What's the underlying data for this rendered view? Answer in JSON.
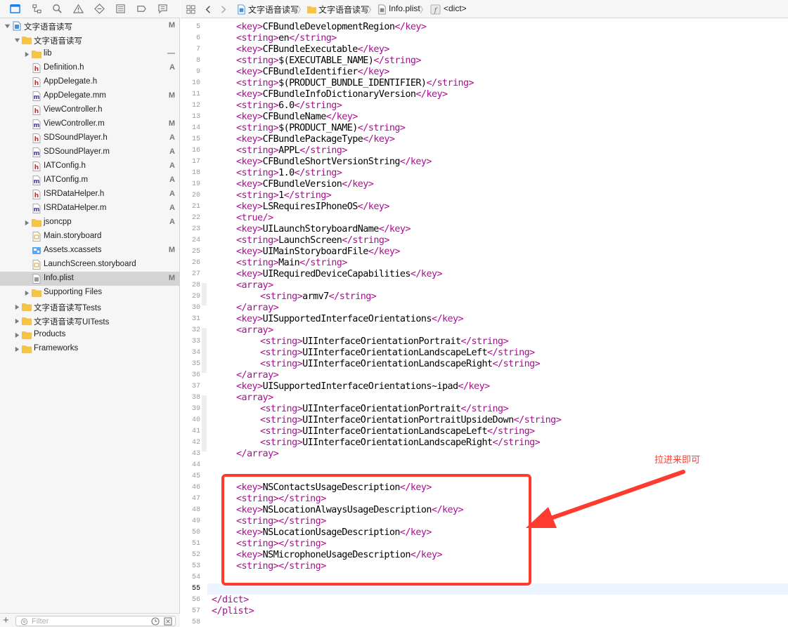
{
  "navigator": {
    "filter_placeholder": "Filter",
    "tree": [
      {
        "name": "文字语音读写",
        "badge": "M",
        "icon": "project-icon",
        "level": 0,
        "disclosure": "open"
      },
      {
        "name": "文字语音读写",
        "badge": "",
        "icon": "folder-icon",
        "level": 1,
        "disclosure": "open"
      },
      {
        "name": "lib",
        "badge": "—",
        "icon": "folder-icon",
        "level": 2,
        "disclosure": "closed"
      },
      {
        "name": "Definition.h",
        "badge": "A",
        "icon": "header-file-icon",
        "level": 2,
        "disclosure": ""
      },
      {
        "name": "AppDelegate.h",
        "badge": "",
        "icon": "header-file-icon",
        "level": 2,
        "disclosure": ""
      },
      {
        "name": "AppDelegate.mm",
        "badge": "M",
        "icon": "source-file-icon",
        "level": 2,
        "disclosure": ""
      },
      {
        "name": "ViewController.h",
        "badge": "",
        "icon": "header-file-icon",
        "level": 2,
        "disclosure": ""
      },
      {
        "name": "ViewController.m",
        "badge": "M",
        "icon": "source-file-icon",
        "level": 2,
        "disclosure": ""
      },
      {
        "name": "SDSoundPlayer.h",
        "badge": "A",
        "icon": "header-file-icon",
        "level": 2,
        "disclosure": ""
      },
      {
        "name": "SDSoundPlayer.m",
        "badge": "A",
        "icon": "source-file-icon",
        "level": 2,
        "disclosure": ""
      },
      {
        "name": "IATConfig.h",
        "badge": "A",
        "icon": "header-file-icon",
        "level": 2,
        "disclosure": ""
      },
      {
        "name": "IATConfig.m",
        "badge": "A",
        "icon": "source-file-icon",
        "level": 2,
        "disclosure": ""
      },
      {
        "name": "ISRDataHelper.h",
        "badge": "A",
        "icon": "header-file-icon",
        "level": 2,
        "disclosure": ""
      },
      {
        "name": "ISRDataHelper.m",
        "badge": "A",
        "icon": "source-file-icon",
        "level": 2,
        "disclosure": ""
      },
      {
        "name": "jsoncpp",
        "badge": "A",
        "icon": "folder-icon",
        "level": 2,
        "disclosure": "closed"
      },
      {
        "name": "Main.storyboard",
        "badge": "",
        "icon": "storyboard-icon",
        "level": 2,
        "disclosure": ""
      },
      {
        "name": "Assets.xcassets",
        "badge": "M",
        "icon": "asset-catalog-icon",
        "level": 2,
        "disclosure": ""
      },
      {
        "name": "LaunchScreen.storyboard",
        "badge": "",
        "icon": "storyboard-icon",
        "level": 2,
        "disclosure": ""
      },
      {
        "name": "Info.plist",
        "badge": "M",
        "icon": "plist-file-icon",
        "level": 2,
        "disclosure": "",
        "selected": true
      },
      {
        "name": "Supporting Files",
        "badge": "",
        "icon": "folder-icon",
        "level": 2,
        "disclosure": "closed"
      },
      {
        "name": "文字语音读写Tests",
        "badge": "",
        "icon": "folder-icon",
        "level": 1,
        "disclosure": "closed"
      },
      {
        "name": "文字语音读写UITests",
        "badge": "",
        "icon": "folder-icon",
        "level": 1,
        "disclosure": "closed"
      },
      {
        "name": "Products",
        "badge": "",
        "icon": "folder-icon",
        "level": 1,
        "disclosure": "closed"
      },
      {
        "name": "Frameworks",
        "badge": "",
        "icon": "folder-icon",
        "level": 1,
        "disclosure": "closed"
      }
    ]
  },
  "jumpbar": {
    "items": [
      "文字语音读写",
      "文字语音读写",
      "Info.plist",
      "<dict>"
    ]
  },
  "editor": {
    "current_line": 55,
    "lines": [
      {
        "n": 5,
        "indent": 1,
        "parts": [
          [
            "t",
            "<key>"
          ],
          [
            "x",
            "CFBundleDevelopmentRegion"
          ],
          [
            "t",
            "</key>"
          ]
        ]
      },
      {
        "n": 6,
        "indent": 1,
        "parts": [
          [
            "t",
            "<string>"
          ],
          [
            "x",
            "en"
          ],
          [
            "t",
            "</string>"
          ]
        ]
      },
      {
        "n": 7,
        "indent": 1,
        "parts": [
          [
            "t",
            "<key>"
          ],
          [
            "x",
            "CFBundleExecutable"
          ],
          [
            "t",
            "</key>"
          ]
        ]
      },
      {
        "n": 8,
        "indent": 1,
        "parts": [
          [
            "t",
            "<string>"
          ],
          [
            "x",
            "$(EXECUTABLE_NAME)"
          ],
          [
            "t",
            "</string>"
          ]
        ]
      },
      {
        "n": 9,
        "indent": 1,
        "parts": [
          [
            "t",
            "<key>"
          ],
          [
            "x",
            "CFBundleIdentifier"
          ],
          [
            "t",
            "</key>"
          ]
        ]
      },
      {
        "n": 10,
        "indent": 1,
        "parts": [
          [
            "t",
            "<string>"
          ],
          [
            "x",
            "$(PRODUCT_BUNDLE_IDENTIFIER)"
          ],
          [
            "t",
            "</string>"
          ]
        ]
      },
      {
        "n": 11,
        "indent": 1,
        "parts": [
          [
            "t",
            "<key>"
          ],
          [
            "x",
            "CFBundleInfoDictionaryVersion"
          ],
          [
            "t",
            "</key>"
          ]
        ]
      },
      {
        "n": 12,
        "indent": 1,
        "parts": [
          [
            "t",
            "<string>"
          ],
          [
            "x",
            "6.0"
          ],
          [
            "t",
            "</string>"
          ]
        ]
      },
      {
        "n": 13,
        "indent": 1,
        "parts": [
          [
            "t",
            "<key>"
          ],
          [
            "x",
            "CFBundleName"
          ],
          [
            "t",
            "</key>"
          ]
        ]
      },
      {
        "n": 14,
        "indent": 1,
        "parts": [
          [
            "t",
            "<string>"
          ],
          [
            "x",
            "$(PRODUCT_NAME)"
          ],
          [
            "t",
            "</string>"
          ]
        ]
      },
      {
        "n": 15,
        "indent": 1,
        "parts": [
          [
            "t",
            "<key>"
          ],
          [
            "x",
            "CFBundlePackageType"
          ],
          [
            "t",
            "</key>"
          ]
        ]
      },
      {
        "n": 16,
        "indent": 1,
        "parts": [
          [
            "t",
            "<string>"
          ],
          [
            "x",
            "APPL"
          ],
          [
            "t",
            "</string>"
          ]
        ]
      },
      {
        "n": 17,
        "indent": 1,
        "parts": [
          [
            "t",
            "<key>"
          ],
          [
            "x",
            "CFBundleShortVersionString"
          ],
          [
            "t",
            "</key>"
          ]
        ]
      },
      {
        "n": 18,
        "indent": 1,
        "parts": [
          [
            "t",
            "<string>"
          ],
          [
            "x",
            "1.0"
          ],
          [
            "t",
            "</string>"
          ]
        ]
      },
      {
        "n": 19,
        "indent": 1,
        "parts": [
          [
            "t",
            "<key>"
          ],
          [
            "x",
            "CFBundleVersion"
          ],
          [
            "t",
            "</key>"
          ]
        ]
      },
      {
        "n": 20,
        "indent": 1,
        "parts": [
          [
            "t",
            "<string>"
          ],
          [
            "x",
            "1"
          ],
          [
            "t",
            "</string>"
          ]
        ]
      },
      {
        "n": 21,
        "indent": 1,
        "parts": [
          [
            "t",
            "<key>"
          ],
          [
            "x",
            "LSRequiresIPhoneOS"
          ],
          [
            "t",
            "</key>"
          ]
        ]
      },
      {
        "n": 22,
        "indent": 1,
        "parts": [
          [
            "t",
            "<true/>"
          ]
        ]
      },
      {
        "n": 23,
        "indent": 1,
        "parts": [
          [
            "t",
            "<key>"
          ],
          [
            "x",
            "UILaunchStoryboardName"
          ],
          [
            "t",
            "</key>"
          ]
        ]
      },
      {
        "n": 24,
        "indent": 1,
        "parts": [
          [
            "t",
            "<string>"
          ],
          [
            "x",
            "LaunchScreen"
          ],
          [
            "t",
            "</string>"
          ]
        ]
      },
      {
        "n": 25,
        "indent": 1,
        "parts": [
          [
            "t",
            "<key>"
          ],
          [
            "x",
            "UIMainStoryboardFile"
          ],
          [
            "t",
            "</key>"
          ]
        ]
      },
      {
        "n": 26,
        "indent": 1,
        "parts": [
          [
            "t",
            "<string>"
          ],
          [
            "x",
            "Main"
          ],
          [
            "t",
            "</string>"
          ]
        ]
      },
      {
        "n": 27,
        "indent": 1,
        "parts": [
          [
            "t",
            "<key>"
          ],
          [
            "x",
            "UIRequiredDeviceCapabilities"
          ],
          [
            "t",
            "</key>"
          ]
        ]
      },
      {
        "n": 28,
        "indent": 1,
        "parts": [
          [
            "t",
            "<array>"
          ]
        ]
      },
      {
        "n": 29,
        "indent": 2,
        "parts": [
          [
            "t",
            "<string>"
          ],
          [
            "x",
            "armv7"
          ],
          [
            "t",
            "</string>"
          ]
        ]
      },
      {
        "n": 30,
        "indent": 1,
        "parts": [
          [
            "t",
            "</array>"
          ]
        ]
      },
      {
        "n": 31,
        "indent": 1,
        "parts": [
          [
            "t",
            "<key>"
          ],
          [
            "x",
            "UISupportedInterfaceOrientations"
          ],
          [
            "t",
            "</key>"
          ]
        ]
      },
      {
        "n": 32,
        "indent": 1,
        "parts": [
          [
            "t",
            "<array>"
          ]
        ]
      },
      {
        "n": 33,
        "indent": 2,
        "parts": [
          [
            "t",
            "<string>"
          ],
          [
            "x",
            "UIInterfaceOrientationPortrait"
          ],
          [
            "t",
            "</string>"
          ]
        ]
      },
      {
        "n": 34,
        "indent": 2,
        "parts": [
          [
            "t",
            "<string>"
          ],
          [
            "x",
            "UIInterfaceOrientationLandscapeLeft"
          ],
          [
            "t",
            "</string>"
          ]
        ]
      },
      {
        "n": 35,
        "indent": 2,
        "parts": [
          [
            "t",
            "<string>"
          ],
          [
            "x",
            "UIInterfaceOrientationLandscapeRight"
          ],
          [
            "t",
            "</string>"
          ]
        ]
      },
      {
        "n": 36,
        "indent": 1,
        "parts": [
          [
            "t",
            "</array>"
          ]
        ]
      },
      {
        "n": 37,
        "indent": 1,
        "parts": [
          [
            "t",
            "<key>"
          ],
          [
            "x",
            "UISupportedInterfaceOrientations~ipad"
          ],
          [
            "t",
            "</key>"
          ]
        ]
      },
      {
        "n": 38,
        "indent": 1,
        "parts": [
          [
            "t",
            "<array>"
          ]
        ]
      },
      {
        "n": 39,
        "indent": 2,
        "parts": [
          [
            "t",
            "<string>"
          ],
          [
            "x",
            "UIInterfaceOrientationPortrait"
          ],
          [
            "t",
            "</string>"
          ]
        ]
      },
      {
        "n": 40,
        "indent": 2,
        "parts": [
          [
            "t",
            "<string>"
          ],
          [
            "x",
            "UIInterfaceOrientationPortraitUpsideDown"
          ],
          [
            "t",
            "</string>"
          ]
        ]
      },
      {
        "n": 41,
        "indent": 2,
        "parts": [
          [
            "t",
            "<string>"
          ],
          [
            "x",
            "UIInterfaceOrientationLandscapeLeft"
          ],
          [
            "t",
            "</string>"
          ]
        ]
      },
      {
        "n": 42,
        "indent": 2,
        "parts": [
          [
            "t",
            "<string>"
          ],
          [
            "x",
            "UIInterfaceOrientationLandscapeRight"
          ],
          [
            "t",
            "</string>"
          ]
        ]
      },
      {
        "n": 43,
        "indent": 1,
        "parts": [
          [
            "t",
            "</array>"
          ]
        ]
      },
      {
        "n": 44,
        "indent": 0,
        "parts": []
      },
      {
        "n": 45,
        "indent": 0,
        "parts": []
      },
      {
        "n": 46,
        "indent": 1,
        "parts": [
          [
            "t",
            "<key>"
          ],
          [
            "x",
            "NSContactsUsageDescription"
          ],
          [
            "t",
            "</key>"
          ]
        ]
      },
      {
        "n": 47,
        "indent": 1,
        "parts": [
          [
            "t",
            "<string></string>"
          ]
        ]
      },
      {
        "n": 48,
        "indent": 1,
        "parts": [
          [
            "t",
            "<key>"
          ],
          [
            "x",
            "NSLocationAlwaysUsageDescription"
          ],
          [
            "t",
            "</key>"
          ]
        ]
      },
      {
        "n": 49,
        "indent": 1,
        "parts": [
          [
            "t",
            "<string></string>"
          ]
        ]
      },
      {
        "n": 50,
        "indent": 1,
        "parts": [
          [
            "t",
            "<key>"
          ],
          [
            "x",
            "NSLocationUsageDescription"
          ],
          [
            "t",
            "</key>"
          ]
        ]
      },
      {
        "n": 51,
        "indent": 1,
        "parts": [
          [
            "t",
            "<string></string>"
          ]
        ]
      },
      {
        "n": 52,
        "indent": 1,
        "parts": [
          [
            "t",
            "<key>"
          ],
          [
            "x",
            "NSMicrophoneUsageDescription"
          ],
          [
            "t",
            "</key>"
          ]
        ]
      },
      {
        "n": 53,
        "indent": 1,
        "parts": [
          [
            "t",
            "<string></string>"
          ]
        ]
      },
      {
        "n": 54,
        "indent": 0,
        "parts": []
      },
      {
        "n": 55,
        "indent": 0,
        "parts": []
      },
      {
        "n": 56,
        "indent": 0,
        "parts": [
          [
            "t",
            "</dict>"
          ]
        ]
      },
      {
        "n": 57,
        "indent": 0,
        "parts": [
          [
            "t",
            "</plist>"
          ]
        ]
      },
      {
        "n": 58,
        "indent": 0,
        "parts": []
      }
    ]
  },
  "annotation": {
    "text": "拉进来即可",
    "color": "#ff3b30"
  },
  "colors": {
    "tag": "#a90d91",
    "folder": "#f6c544",
    "selection": "#d4d4d4",
    "accent": "#1b7ef0"
  }
}
